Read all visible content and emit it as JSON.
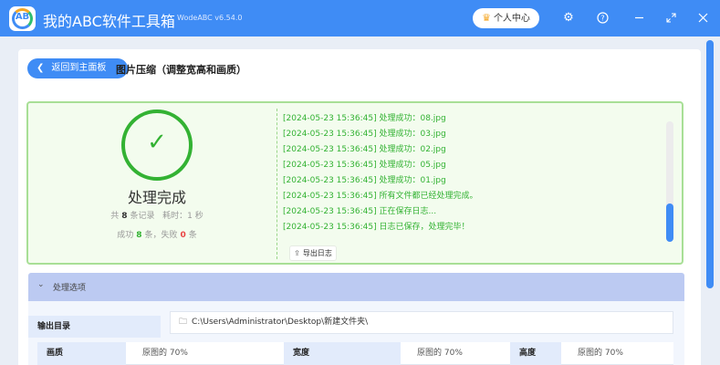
{
  "app": {
    "logo_text": "AB",
    "title": "我的ABC软件工具箱",
    "version": "WodeABC v6.54.0",
    "vip_label": "个人中心",
    "icons": [
      "crown-icon",
      "settings-icon",
      "help-icon",
      "minimize-icon",
      "restore-icon",
      "close-icon"
    ]
  },
  "page": {
    "back_label": "返回到主面板",
    "title": "图片压缩（调整宽高和画质）"
  },
  "result": {
    "status": "处理完成",
    "total_prefix": "共",
    "total_count": "8",
    "total_suffix": "条记录",
    "time_prefix": "耗时：",
    "time_value": "1",
    "time_suffix": "秒",
    "success_prefix": "成功",
    "success_count": "8",
    "success_suffix": "条，失败",
    "fail_count": "0",
    "fail_suffix": "条",
    "log": [
      "[2024-05-23 15:36:45] 处理成功：08.jpg",
      "[2024-05-23 15:36:45] 处理成功：03.jpg",
      "[2024-05-23 15:36:45] 处理成功：02.jpg",
      "[2024-05-23 15:36:45] 处理成功：05.jpg",
      "[2024-05-23 15:36:45] 处理成功：01.jpg",
      "[2024-05-23 15:36:45] 所有文件都已经处理完成。",
      "[2024-05-23 15:36:45] 正在保存日志...",
      "[2024-05-23 15:36:45] 日志已保存，处理完毕！"
    ],
    "export_label": "导出日志"
  },
  "options": {
    "header": "处理选项",
    "output_label": "输出目录",
    "output_path": "C:\\Users\\Administrator\\Desktop\\新建文件夹\\",
    "quality_label": "画质",
    "quality_value": "原图的 70%",
    "width_label": "宽度",
    "width_value": "原图的 70%",
    "height_label": "高度",
    "height_value": "原图的 70%"
  },
  "colors": {
    "primary": "#3f8cf5",
    "success": "#33b233",
    "fail": "#e94343",
    "accent": "#f5a623"
  }
}
